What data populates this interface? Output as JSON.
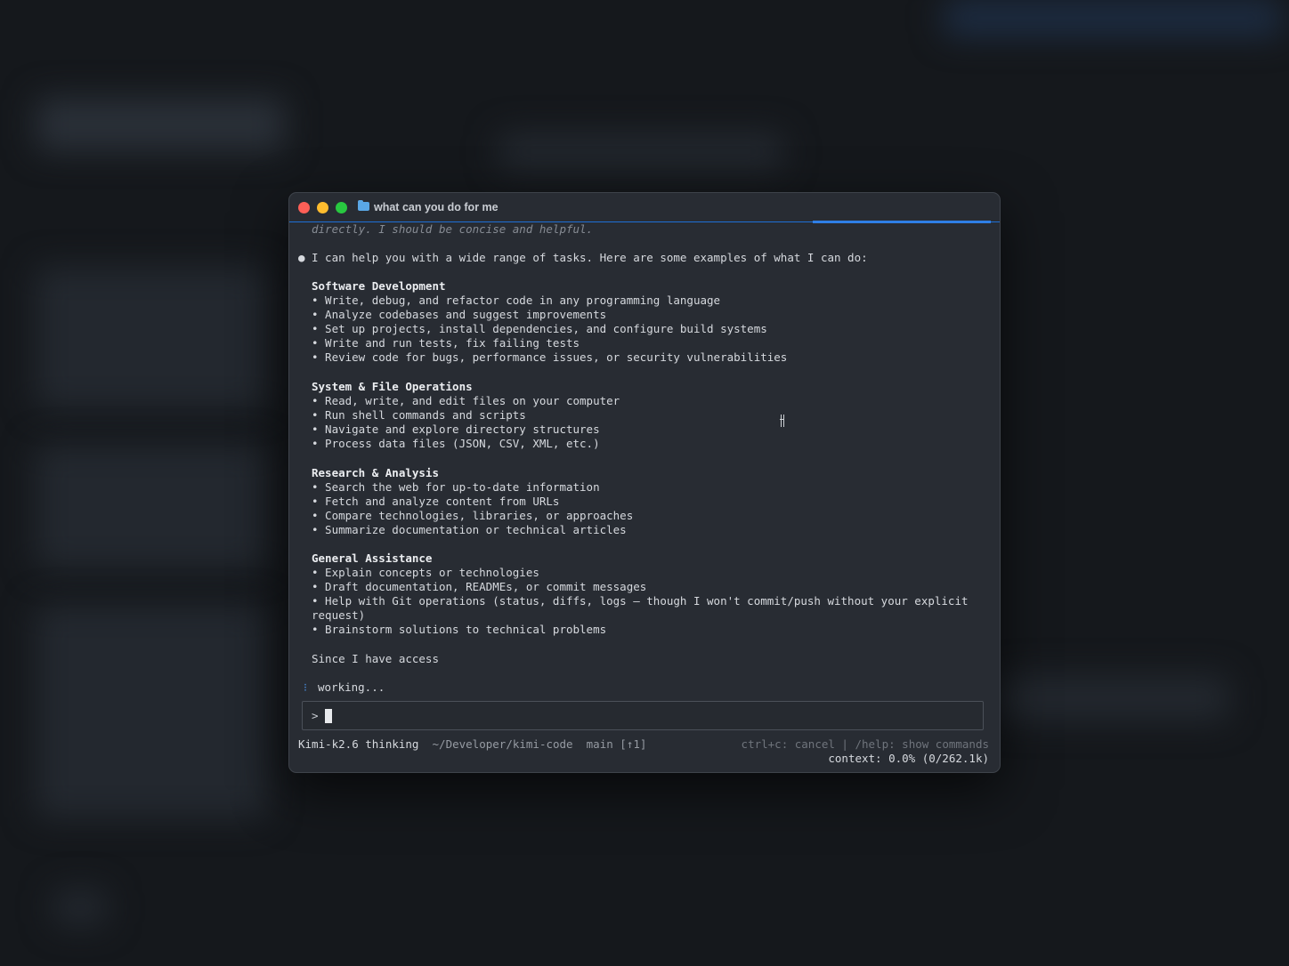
{
  "window": {
    "title": "what can you do for me"
  },
  "conversation": {
    "thinking_tail": "directly. I should be concise and helpful.",
    "intro": "I can help you with a wide range of tasks. Here are some examples of what I can do:",
    "sections": [
      {
        "heading": "Software Development",
        "items": [
          "• Write, debug, and refactor code in any programming language",
          "• Analyze codebases and suggest improvements",
          "• Set up projects, install dependencies, and configure build systems",
          "• Write and run tests, fix failing tests",
          "• Review code for bugs, performance issues, or security vulnerabilities"
        ]
      },
      {
        "heading": "System & File Operations",
        "items": [
          "• Read, write, and edit files on your computer",
          "• Run shell commands and scripts",
          "• Navigate and explore directory structures",
          "• Process data files (JSON, CSV, XML, etc.)"
        ]
      },
      {
        "heading": "Research & Analysis",
        "items": [
          "• Search the web for up-to-date information",
          "• Fetch and analyze content from URLs",
          "• Compare technologies, libraries, or approaches",
          "• Summarize documentation or technical articles"
        ]
      },
      {
        "heading": "General Assistance",
        "items": [
          "• Explain concepts or technologies",
          "• Draft documentation, READMEs, or commit messages",
          "• Help with Git operations (status, diffs, logs — though I won't commit/push without your explicit",
          "request)",
          "• Brainstorm solutions to technical problems"
        ]
      }
    ],
    "trailing": "Since I have access",
    "status": "working..."
  },
  "input": {
    "prompt": ">"
  },
  "statusbar": {
    "model": "Kimi-k2.6 thinking",
    "path": "~/Developer/kimi-code",
    "branch": "main [↑1]",
    "hints": "ctrl+c: cancel | /help: show commands",
    "context": "context: 0.0% (0/262.1k)"
  }
}
